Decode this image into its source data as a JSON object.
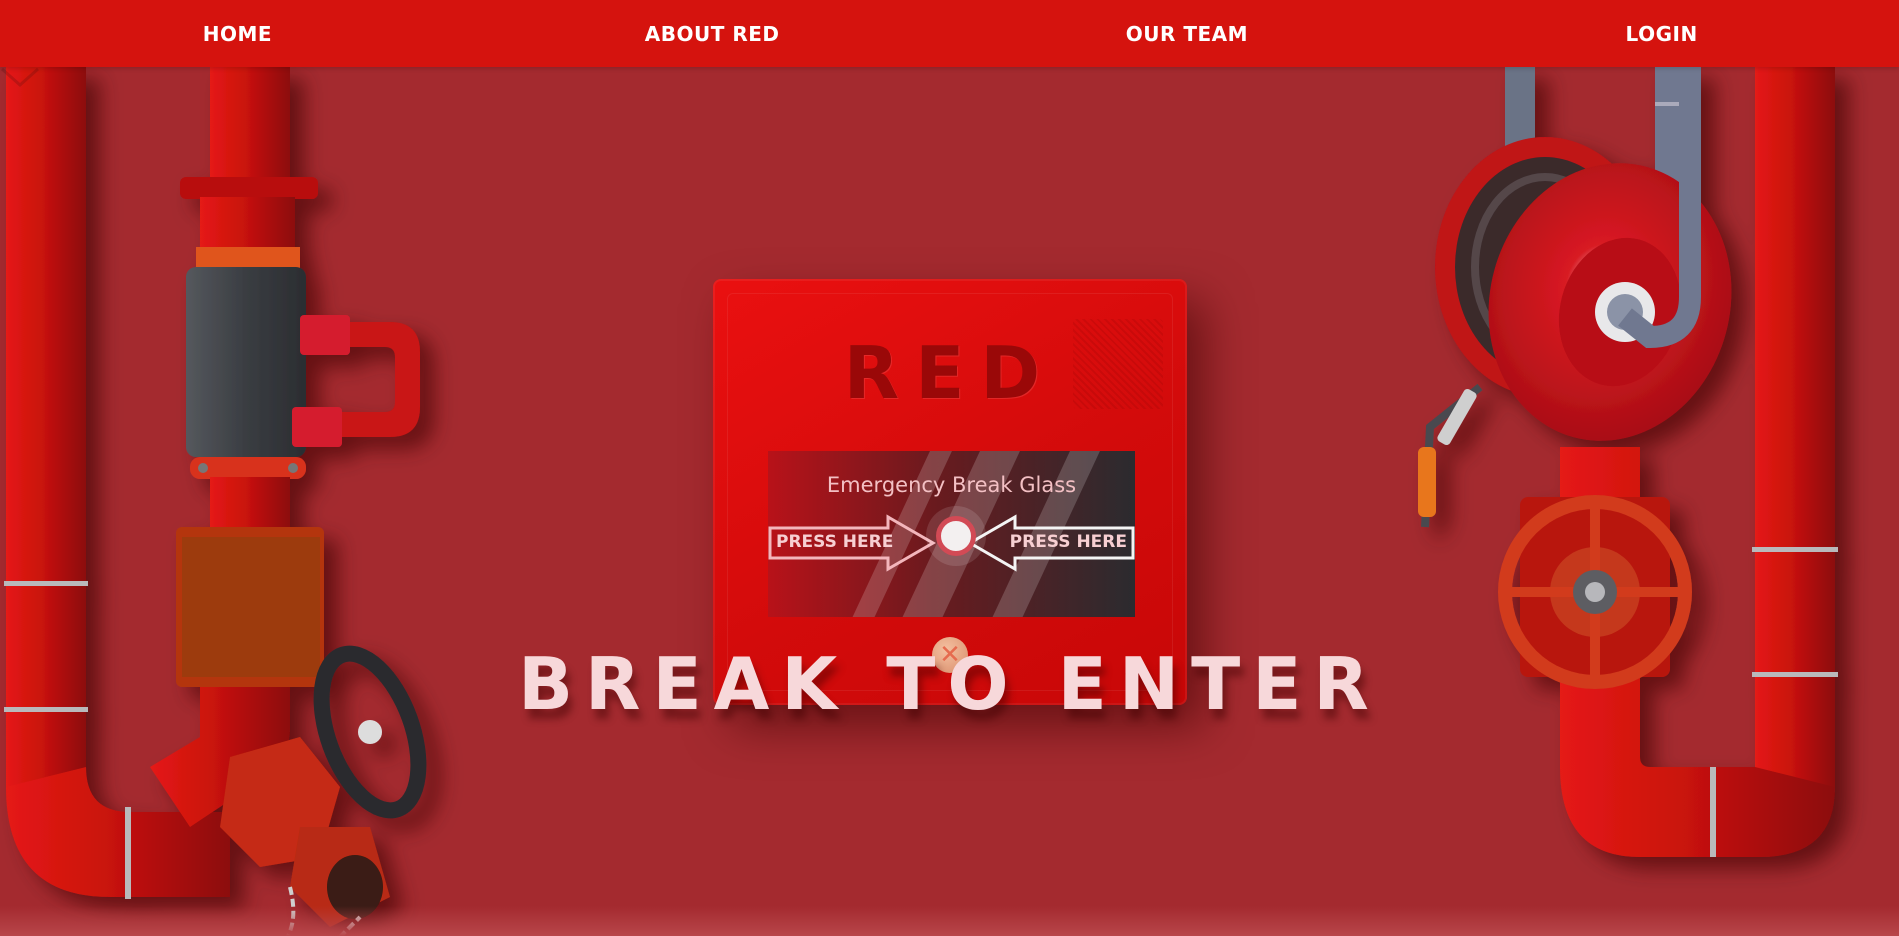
{
  "nav": {
    "home": "HOME",
    "about": "ABOUT RED",
    "team": "OUR TEAM",
    "login": "LOGIN"
  },
  "panel": {
    "brand": "RED",
    "glass_title": "Emergency Break Glass",
    "press_left": "PRESS HERE",
    "press_right": "PRESS HERE"
  },
  "headline": "BREAK TO ENTER",
  "colors": {
    "nav_bg": "#d5130e",
    "background": "#a42a2f",
    "panel": "#e00e0e",
    "headline": "#f7d8da"
  },
  "icons": {
    "scroll": "chevron-down-icon",
    "screw": "screw-icon"
  }
}
